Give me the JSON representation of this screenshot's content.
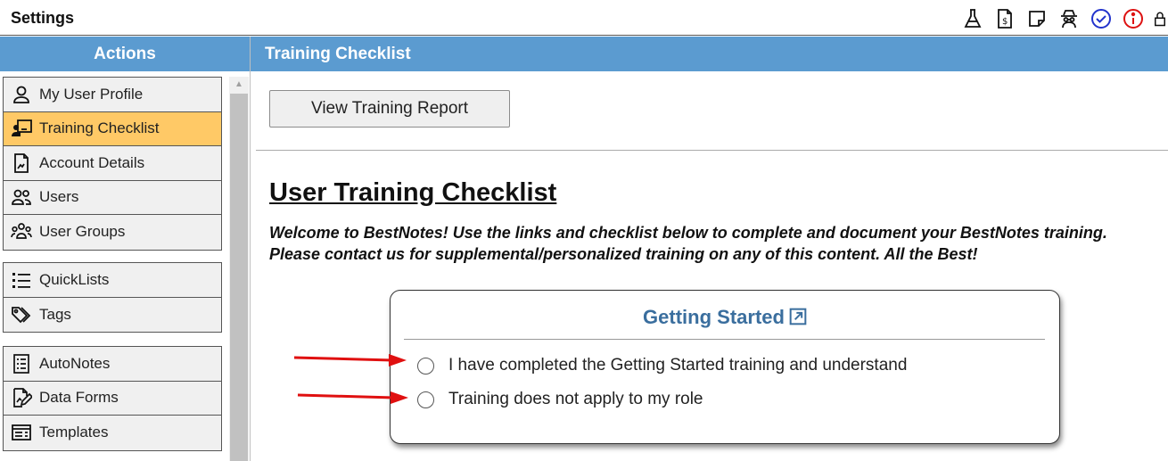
{
  "app": {
    "title": "Settings"
  },
  "top_icons": [
    "flask-icon",
    "invoice-icon",
    "sticky-note-icon",
    "spy-icon",
    "check-circle-icon",
    "info-circle-icon",
    "lock-icon"
  ],
  "sidebar": {
    "header": "Actions",
    "groups": [
      [
        {
          "label": "My User Profile",
          "icon": "user-icon"
        },
        {
          "label": "Training Checklist",
          "icon": "training-board-icon",
          "active": true
        },
        {
          "label": "Account Details",
          "icon": "document-icon"
        },
        {
          "label": "Users",
          "icon": "users-icon"
        },
        {
          "label": "User Groups",
          "icon": "user-groups-icon"
        }
      ],
      [
        {
          "label": "QuickLists",
          "icon": "list-icon"
        },
        {
          "label": "Tags",
          "icon": "tags-icon"
        }
      ],
      [
        {
          "label": "AutoNotes",
          "icon": "checklist-doc-icon"
        },
        {
          "label": "Data Forms",
          "icon": "form-edit-icon"
        },
        {
          "label": "Templates",
          "icon": "template-icon"
        }
      ]
    ]
  },
  "main": {
    "header": "Training Checklist",
    "report_button": "View Training Report",
    "title": "User Training Checklist",
    "welcome": "Welcome to BestNotes! Use the links and checklist below to complete and document your BestNotes training. Please contact us for supplemental/personalized training on any of this content. All the Best!",
    "card": {
      "title": "Getting Started",
      "options": [
        "I have completed the Getting Started training and understand",
        "Training does not apply to my role"
      ]
    }
  },
  "colors": {
    "band": "#5b9bd0",
    "active_item": "#ffc966",
    "card_title": "#3a6e9e",
    "arrow": "#e01010"
  }
}
